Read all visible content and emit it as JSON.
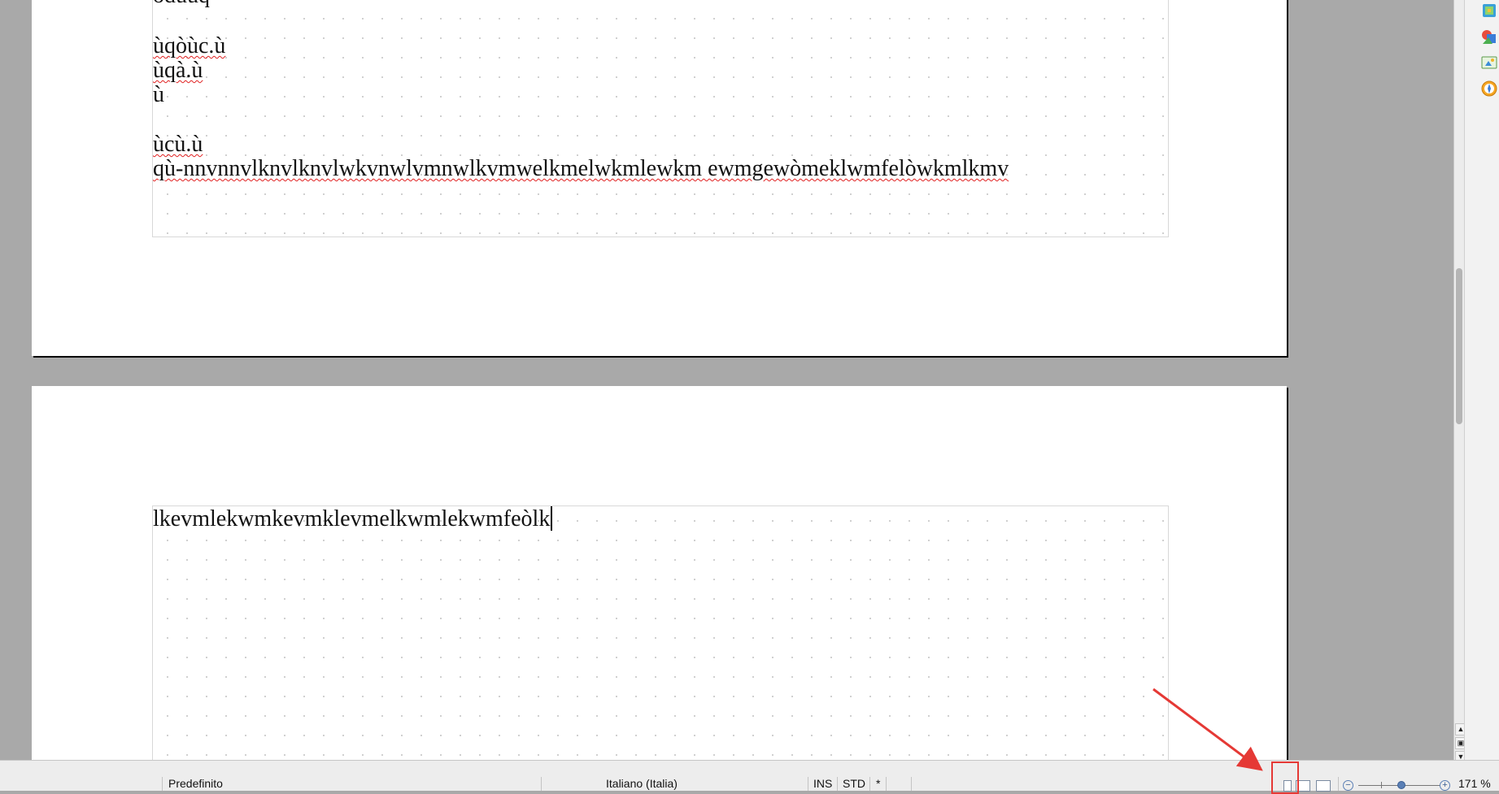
{
  "document": {
    "page1_lines": [
      {
        "text": "òdùuq",
        "spell_error": false
      },
      {
        "text": "ùqòùc.ù",
        "spell_error": true
      },
      {
        "text": "ùqà.ù",
        "spell_error": true
      },
      {
        "text": "ù",
        "spell_error": false
      },
      {
        "text": "ùcù.ù",
        "spell_error": true
      },
      {
        "text": "qù-nnvnnvlknvlknvlwkvnwlvmnwlkvmwelkmelwkmlewkm ewmgewòmeklwmfelòwkmlkmv",
        "spell_error": true
      }
    ],
    "page2_lines": [
      {
        "text": "lkevmlekwmkevmklevmelkwmlekwmfeòlk",
        "spell_error": false
      }
    ]
  },
  "sidebar": {
    "icons": [
      "properties-icon",
      "gallery-icon",
      "navigator-icon",
      "compass-icon"
    ]
  },
  "scroll_nav": {
    "prev": "▲",
    "page": "▣",
    "next": "▼"
  },
  "statusbar": {
    "page_style": "Predefinito",
    "language": "Italiano (Italia)",
    "insert_mode": "INS",
    "selection_mode": "STD",
    "modified": "*",
    "zoom_minus": "−",
    "zoom_plus": "+",
    "zoom": "171 %"
  },
  "colors": {
    "workspace": "#a9a9a9",
    "spell_underline": "#e02020",
    "annotation": "#e53935"
  }
}
